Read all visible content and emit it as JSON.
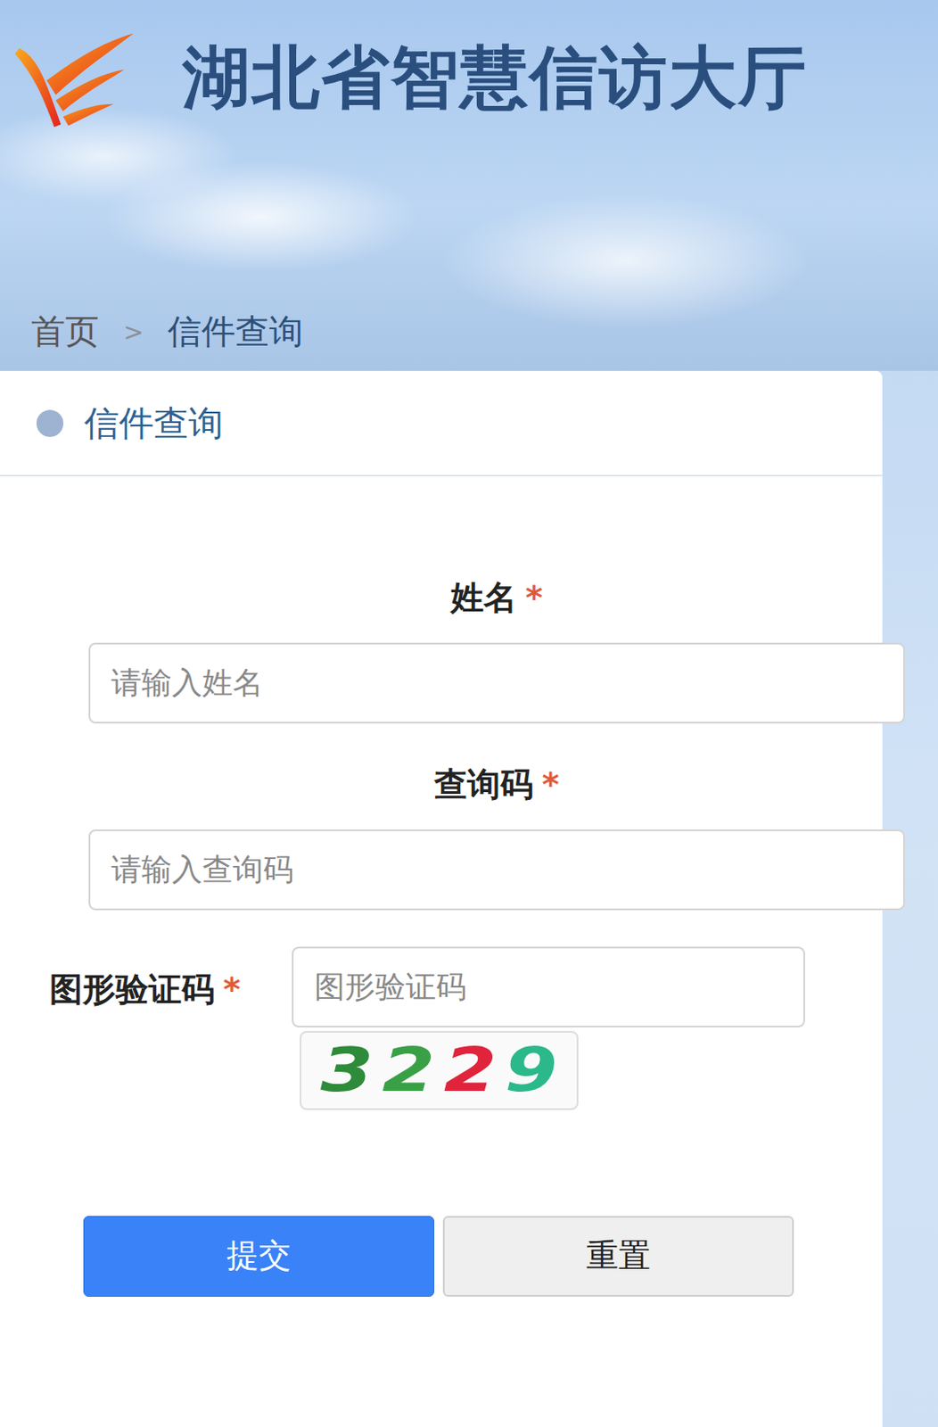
{
  "header": {
    "title": "湖北省智慧信访大厅"
  },
  "breadcrumb": {
    "items": [
      {
        "label": "首页",
        "selected": false
      },
      {
        "label": "信件查询",
        "selected": true
      }
    ],
    "separator": ">"
  },
  "panel": {
    "title": "信件查询"
  },
  "fields": [
    {
      "label": "姓名",
      "mark": "*",
      "placeholder": "请输入姓名"
    },
    {
      "label": "查询码",
      "mark": "*",
      "placeholder": "请输入查询码"
    }
  ],
  "captcha": {
    "label": "图形验证码",
    "mark": "*",
    "placeholder": "图形验证码",
    "digits": [
      {
        "text": "3",
        "color": "#2e8b3a"
      },
      {
        "text": "2",
        "color": "#3aa046"
      },
      {
        "text": "2",
        "color": "#e0243c"
      },
      {
        "text": "9",
        "color": "#2bb88a"
      }
    ]
  },
  "buttons": [
    {
      "label": "提交",
      "kind": "primary"
    },
    {
      "label": "重置",
      "kind": "secondary"
    }
  ]
}
